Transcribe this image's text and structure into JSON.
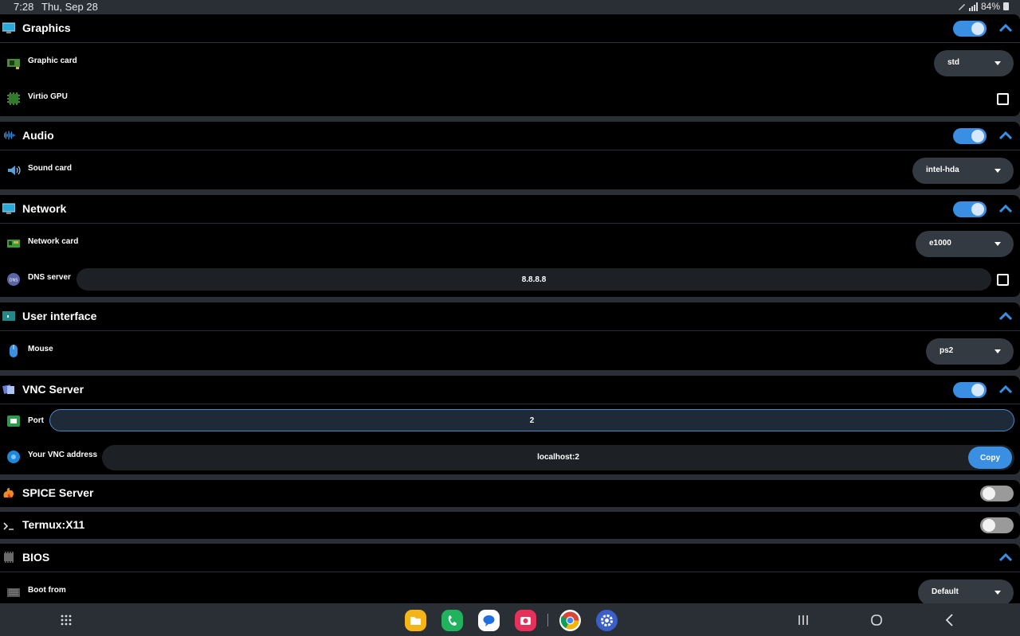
{
  "status": {
    "time": "7:28",
    "date": "Thu, Sep 28",
    "battery": "84%"
  },
  "graphics": {
    "title": "Graphics",
    "enabled": true,
    "graphic_card_label": "Graphic card",
    "graphic_card_value": "std",
    "virtio_label": "Virtio GPU",
    "virtio_checked": false
  },
  "audio": {
    "title": "Audio",
    "enabled": true,
    "sound_card_label": "Sound card",
    "sound_card_value": "intel-hda"
  },
  "network": {
    "title": "Network",
    "enabled": true,
    "network_card_label": "Network card",
    "network_card_value": "e1000",
    "dns_label": "DNS server",
    "dns_value": "8.8.8.8",
    "dns_checked": false
  },
  "ui": {
    "title": "User interface",
    "mouse_label": "Mouse",
    "mouse_value": "ps2"
  },
  "vnc": {
    "title": "VNC Server",
    "enabled": true,
    "port_label": "Port",
    "port_value": "2",
    "address_label": "Your VNC address",
    "address_value": "localhost:2",
    "copy_label": "Copy"
  },
  "spice": {
    "title": "SPICE Server",
    "enabled": false
  },
  "termux": {
    "title": "Termux:X11",
    "enabled": false
  },
  "bios": {
    "title": "BIOS",
    "boot_label": "Boot from",
    "boot_value": "Default"
  },
  "icons": {
    "graphics": "monitor-icon",
    "graphic_card": "gpu-card-icon",
    "virtio": "chip-icon",
    "audio": "waveform-icon",
    "sound_card": "speaker-icon",
    "network": "monitor-icon",
    "network_card": "network-card-icon",
    "dns": "dns-icon",
    "ui": "window-icon",
    "mouse": "mouse-icon",
    "vnc": "vnc-icon",
    "port": "ethernet-port-icon",
    "address": "globe-icon",
    "spice": "spice-icon",
    "termux": "terminal-icon",
    "bios": "chip-icon",
    "boot": "drive-icon"
  },
  "colors": {
    "accent": "#3b8fe3",
    "card_bg": "#000000",
    "page_bg": "#2a2f36",
    "dropdown_bg": "#343a42"
  }
}
